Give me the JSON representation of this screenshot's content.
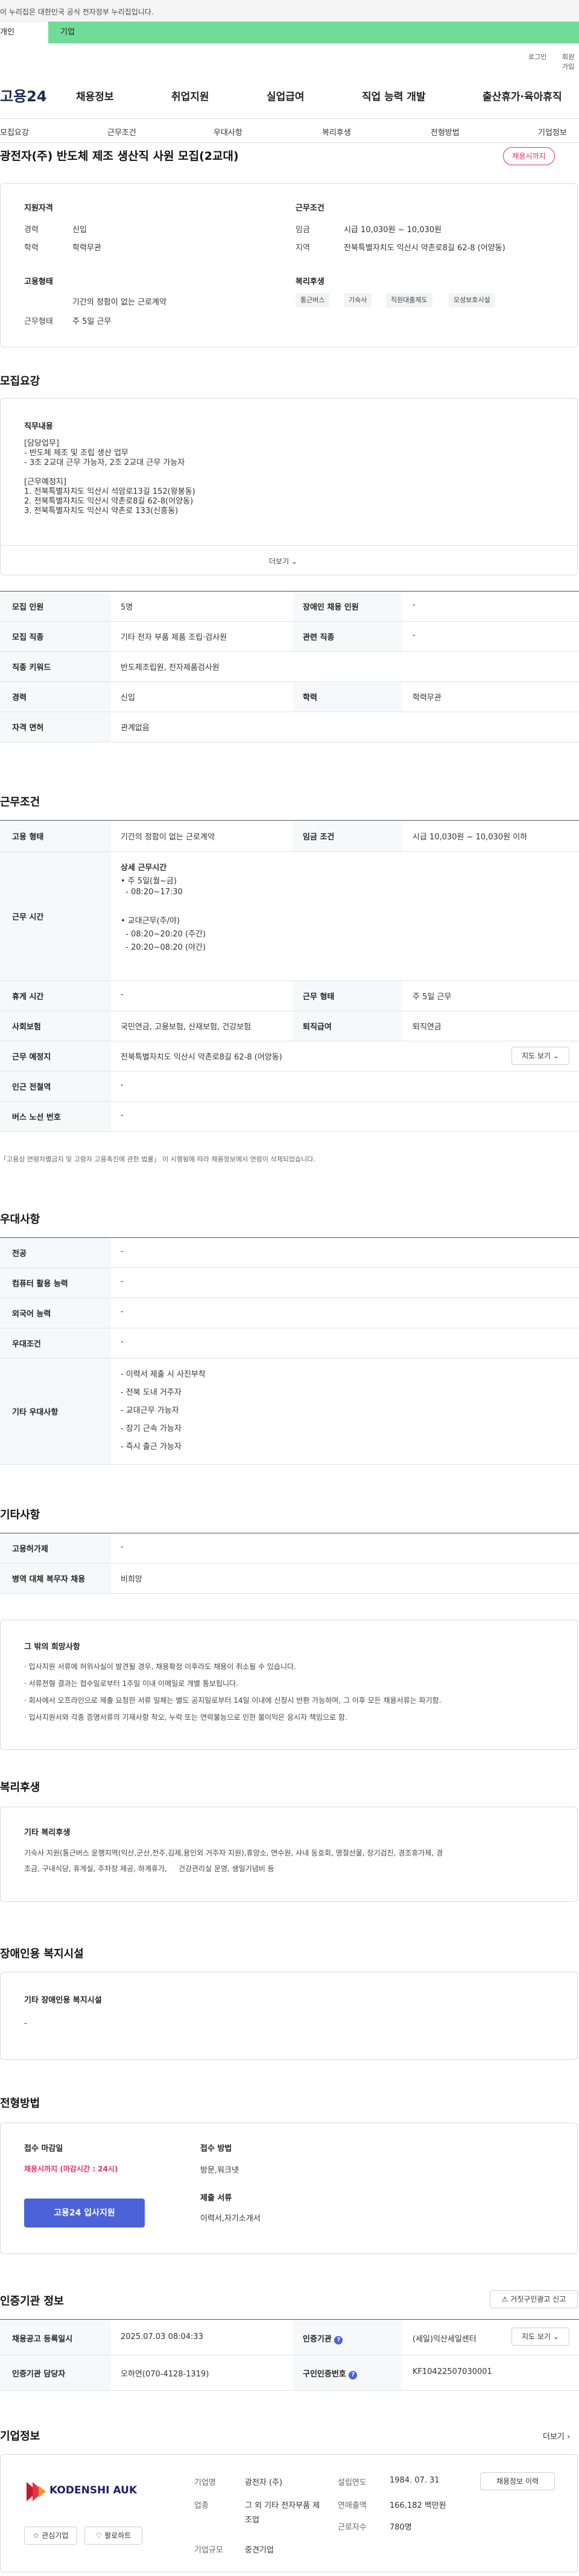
{
  "gov_notice": "이 누리집은 대한민국 공식 전자정부 누리집입니다.",
  "top_tabs": [
    "개인",
    "기업"
  ],
  "util_links": [
    "로그인",
    "회원가입"
  ],
  "logo": "고용24",
  "gnb": [
    "채용정보",
    "취업지원",
    "실업급여",
    "직업 능력 개발",
    "출산휴가·육아휴직"
  ],
  "subnav": [
    "모집요강",
    "근무조건",
    "우대사항",
    "복리후생",
    "전형방법",
    "기업정보"
  ],
  "job_title": "광전자(주) 반도체 제조 생산직 사원 모집(2교대)",
  "status_badge": "채용시까지",
  "summary": {
    "qual_title": "지원자격",
    "career_label": "경력",
    "career_value": "신입",
    "edu_label": "학력",
    "edu_value": "학력무관",
    "emp_title": "고용형태",
    "emp_value": "기간의 정함이 없는 근로계약",
    "workdays_label": "근무형태",
    "workdays_value": "주 5일 근무",
    "cond_title": "근무조건",
    "wage_label": "임금",
    "wage_value": "시급 10,030원 ~ 10,030원",
    "region_label": "지역",
    "region_value": "전북특별자치도 익산시 약촌로8길 62-8 (어양동)",
    "welfare_title": "복리후생",
    "welfare_chips": [
      "통근버스",
      "기숙사",
      "직원대출제도",
      "모성보호시설"
    ]
  },
  "recruit": {
    "title": "모집요강",
    "duty_title": "직무내용",
    "duty_lines": [
      "[담당업무]",
      "- 반도체 제조 및 조립 생산 업무",
      "- 3조 2교대 근무 가능자, 2조 2교대 근무 가능자",
      "",
      "[근무예정지]",
      "1. 전북특별자치도 익산시 석암로13길 152(왕봉동)",
      "2. 전북특별자치도 익산시 약촌로8길 62-8(어양동)",
      "3. 전북특별자치도 익산시 약촌로 133(신흥동)"
    ],
    "more": "더보기 ⌄",
    "rows": [
      {
        "l1": "모집 인원",
        "v1": "5명",
        "l2": "장애인 채용 인원",
        "v2": "-"
      },
      {
        "l1": "모집 직종",
        "v1": "기타 전자 부품 제품 조립·검사원",
        "l2": "관련 직종",
        "v2": "-"
      },
      {
        "l1": "직종 키워드",
        "v1": "반도체조립원, 전자제품검사원",
        "l2": "",
        "v2": ""
      },
      {
        "l1": "경력",
        "v1": "신입",
        "l2": "학력",
        "v2": "학력무관"
      },
      {
        "l1": "자격 면허",
        "v1": "관계없음",
        "l2": "",
        "v2": ""
      }
    ]
  },
  "work": {
    "title": "근무조건",
    "type_label": "고용 형태",
    "type_value": "기간의 정함이 없는 근로계약",
    "wage_label": "임금 조건",
    "wage_value": "시급 10,030원 ~ 10,030원 이하",
    "hours_label": "근무 시간",
    "hours_lines": [
      "상세 근무시간",
      "• 주 5일(월~금)",
      "  - 08:20~17:30",
      "",
      "• 교대근무(주/야)",
      "  - 08:20~20:20 (주간)",
      "  - 20:20~08:20 (야간)"
    ],
    "rest_label": "휴게 시간",
    "rest_value": "-",
    "form_label": "근무 형태",
    "form_value": "주 5일 근무",
    "ins_label": "사회보험",
    "ins_value": "국민연금, 고용보험, 산재보험, 건강보험",
    "ret_label": "퇴직급여",
    "ret_value": "퇴직연금",
    "place_label": "근무 예정지",
    "place_value": "전북특별자치도 익산시 약촌로8길 62-8 (어양동)",
    "map_btn": "지도 보기 ⌄",
    "station_label": "인근 전철역",
    "station_value": "-",
    "bus_label": "버스 노선 번호",
    "bus_value": "-",
    "note": "「고용상 연령차별금지 및 고령자 고용촉진에 관한 법률」 이 시행됨에 따라 채용정보에서 연령이 삭제되었습니다."
  },
  "pref": {
    "title": "우대사항",
    "rows": [
      {
        "l": "전공",
        "v": "-"
      },
      {
        "l": "컴퓨터 활용 능력",
        "v": "-"
      },
      {
        "l": "외국어 능력",
        "v": "-"
      },
      {
        "l": "우대조건",
        "v": "-"
      }
    ],
    "etc_label": "기타 우대사항",
    "etc_lines": [
      "- 이력서 제출 시 사진부착",
      "- 전북 도내 거주자",
      "- 교대근무 가능자",
      "- 장기 근속 가능자",
      "- 즉시 출근 가능자"
    ]
  },
  "other": {
    "title": "기타사항",
    "rows": [
      {
        "l": "고용허가제",
        "v": "-"
      },
      {
        "l": "병역 대체 복무자 채용",
        "v": "비희망"
      }
    ],
    "wish_title": "그 밖의 희망사항",
    "wish_lines": [
      "· 입사지원 서류에 허위사실이 발견될 경우, 채용확정 이후라도 채용이 취소될 수 있습니다.",
      "· 서류전형 결과는 접수일로부터 1주일 이내 이메일로 개별 통보됩니다.",
      "· 회사에서 오프라인으로 제출 요청한 서류 일체는 별도 공지일로부터 14일 이내에 신청시 반환 가능하며, 그 이후 모든 채용서류는 파기함.",
      "· 입사지원서와 각종 증명서류의 기재사항 착오, 누락 또는 연락불능으로 인한 불이익은 응시자 책임으로 함."
    ]
  },
  "welfare": {
    "title": "복리후생",
    "box_title": "기타 복리후생",
    "lines": [
      "기숙사 지원(통근버스 운행지역(익산,군산,전주,김제,용인외 거주자 지원),휴양소, 연수원, 사내 동호회, 명절선물, 장기검진, 경조휴가제, 경",
      "조금, 구내식당, 휴게실, 주차장 제공, 하계휴가,     건강관리실 운영, 생일기념비 등"
    ]
  },
  "disabled": {
    "title": "장애인용 복지시설",
    "box_title": "기타 장애인용 복지시설",
    "value": "-"
  },
  "process": {
    "title": "전형방법",
    "deadline_label": "접수 마감일",
    "deadline_value": "채용시까지 (마감시간 : 24시)",
    "method_label": "접수 방법",
    "method_value": "방문,워크넷",
    "docs_label": "제출 서류",
    "docs_value": "이력서,자기소개서",
    "apply_btn": "고용24 입사지원"
  },
  "agency": {
    "title": "인증기관 정보",
    "report_btn": "거짓구인광고 신고",
    "reg_label": "채용공고 등록일시",
    "reg_value": "2025.07.03 08:04:33",
    "org_label": "인증기관",
    "org_value": "(세일)익산세일센터",
    "map_btn": "지도 보기 ⌄",
    "manager_label": "인증기관 담당자",
    "manager_value": "오하연(070-4128-1319)",
    "id_label": "구인인증번호",
    "id_value": "KF10422507030001"
  },
  "company": {
    "title": "기업정보",
    "more": "더보기 ›",
    "logo_text": "KODENSHI AUK",
    "fav_btn": "관심기업",
    "follow_btn": "팔로하트",
    "name_label": "기업명",
    "name_value": "광전자 (주)",
    "ind_label": "업종",
    "ind_value": "그 외 기타 전자부품 제조업",
    "form_label": "기업규모",
    "form_value": "중견기업",
    "est_label": "설립연도",
    "est_value": "1984. 07. 31",
    "rev_label": "연매출액",
    "rev_value": "166,182 백만원",
    "emp_label": "근로자수",
    "emp_value": "780명",
    "info_btn": "채용정보 이력"
  },
  "colors": {
    "accent": "#4b62d8",
    "alert": "#e3325f",
    "green": "#6fdc98"
  }
}
